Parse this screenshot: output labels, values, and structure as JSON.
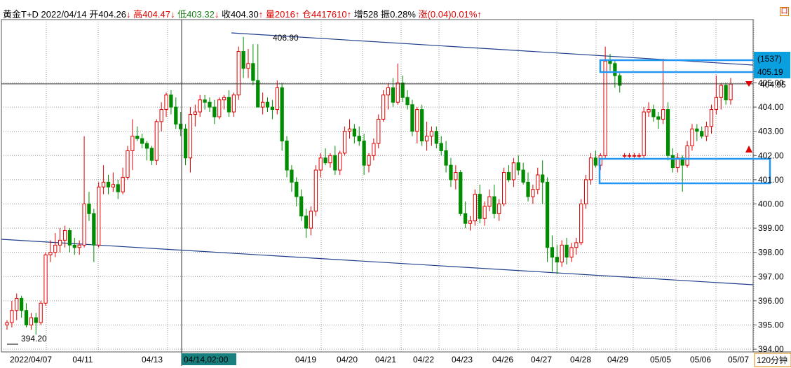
{
  "header": {
    "symbol": "黄金T+D",
    "date": "2022/04/14",
    "open_label": "开",
    "open": "404.26",
    "open_arrow": "↓",
    "high_label": "高",
    "high": "404.47",
    "high_arrow": "↓",
    "low_label": "低",
    "low": "403.32",
    "low_arrow": "↓",
    "close_label": "收",
    "close": "404.30",
    "close_arrow": "↑",
    "vol_label": "量",
    "vol": "2016",
    "vol_arrow": "↑",
    "oi_label": "仓",
    "oi": "4417610",
    "oi_arrow": "↑",
    "inc_label": "增",
    "inc": "528",
    "amp_label": "振",
    "amp": "0.28%",
    "chg_label": "涨",
    "chg": "(0.04)",
    "chg_pct": "0.01%",
    "chg_arrow": "↑",
    "corner": "口"
  },
  "period": "120分钟",
  "crosshair_date": "04/14,02:00",
  "badge_top": "(1537)",
  "badge_price": "405.19",
  "last_price": "404.95",
  "colors": {
    "up": "#e00000",
    "down": "#008c00",
    "box": "#2196f3",
    "trend": "#1f3f8c",
    "badge_bg": "#0aa0e0"
  },
  "chart_data": {
    "type": "candlestick",
    "ylim": [
      393.9,
      407.5
    ],
    "y_ticks": [
      "394.00",
      "395.00",
      "396.00",
      "397.00",
      "398.00",
      "399.00",
      "400.00",
      "401.00",
      "402.00",
      "403.00",
      "404.00",
      "405.00"
    ],
    "x_ticks": [
      "2022/04/07",
      "04/11",
      "04/13",
      "04/19",
      "04/20",
      "04/21",
      "04/22",
      "04/23",
      "04/26",
      "04/27",
      "04/28",
      "04/29",
      "05/05",
      "05/06",
      "05/07"
    ],
    "high_label": "406.90",
    "low_label": "394.20",
    "candles": [
      [
        395.0,
        395.2,
        394.8,
        395.1
      ],
      [
        395.1,
        396.0,
        394.9,
        395.6
      ],
      [
        395.6,
        396.3,
        395.2,
        396.1
      ],
      [
        396.1,
        396.2,
        395.3,
        395.6
      ],
      [
        395.6,
        395.9,
        394.9,
        395.0
      ],
      [
        395.0,
        395.5,
        394.8,
        395.3
      ],
      [
        395.3,
        395.5,
        394.6,
        395.1
      ],
      [
        395.1,
        396.0,
        395.0,
        395.9
      ],
      [
        395.9,
        398.0,
        395.8,
        397.9
      ],
      [
        397.9,
        398.5,
        397.6,
        398.0
      ],
      [
        398.0,
        398.8,
        397.8,
        398.3
      ],
      [
        398.3,
        399.0,
        398.0,
        398.5
      ],
      [
        398.5,
        399.1,
        398.2,
        398.9
      ],
      [
        398.9,
        399.0,
        398.0,
        398.3
      ],
      [
        398.3,
        398.6,
        397.9,
        398.2
      ],
      [
        398.2,
        398.5,
        397.9,
        398.3
      ],
      [
        398.3,
        402.8,
        398.2,
        400.0
      ],
      [
        400.0,
        400.5,
        399.3,
        399.6
      ],
      [
        399.6,
        399.8,
        397.6,
        398.3
      ],
      [
        398.3,
        400.9,
        398.2,
        400.7
      ],
      [
        400.7,
        401.6,
        400.4,
        400.9
      ],
      [
        400.9,
        401.2,
        400.4,
        400.7
      ],
      [
        400.7,
        401.3,
        400.5,
        400.8
      ],
      [
        400.8,
        401.0,
        400.2,
        400.5
      ],
      [
        400.5,
        401.5,
        400.4,
        401.1
      ],
      [
        401.1,
        402.4,
        401.0,
        402.2
      ],
      [
        402.2,
        403.5,
        401.4,
        402.8
      ],
      [
        402.8,
        403.2,
        402.6,
        402.7
      ],
      [
        402.7,
        402.9,
        402.3,
        402.5
      ],
      [
        402.5,
        402.6,
        401.8,
        402.3
      ],
      [
        402.3,
        402.4,
        401.6,
        401.8
      ],
      [
        401.8,
        403.5,
        401.6,
        403.4
      ],
      [
        403.4,
        404.2,
        403.0,
        403.9
      ],
      [
        403.9,
        404.6,
        403.6,
        404.5
      ],
      [
        404.5,
        404.7,
        403.7,
        404.0
      ],
      [
        404.0,
        404.4,
        403.1,
        403.3
      ],
      [
        403.3,
        403.8,
        402.8,
        403.1
      ],
      [
        403.1,
        403.3,
        401.6,
        401.9
      ],
      [
        401.9,
        404.0,
        401.3,
        403.7
      ],
      [
        403.7,
        404.1,
        403.2,
        403.8
      ],
      [
        403.8,
        404.5,
        403.6,
        404.3
      ],
      [
        404.3,
        404.5,
        403.9,
        404.2
      ],
      [
        404.2,
        404.4,
        403.8,
        404.0
      ],
      [
        404.0,
        404.3,
        403.3,
        403.6
      ],
      [
        403.6,
        404.4,
        403.5,
        404.3
      ],
      [
        404.3,
        404.5,
        403.9,
        404.4
      ],
      [
        404.4,
        404.7,
        403.6,
        403.8
      ],
      [
        403.8,
        404.6,
        403.6,
        404.5
      ],
      [
        404.5,
        406.5,
        404.3,
        406.3
      ],
      [
        406.3,
        406.9,
        405.2,
        405.6
      ],
      [
        405.6,
        406.4,
        405.2,
        405.8
      ],
      [
        405.8,
        406.6,
        404.9,
        405.1
      ],
      [
        405.1,
        406.6,
        404.0,
        404.0
      ],
      [
        404.0,
        404.6,
        403.7,
        404.2
      ],
      [
        404.2,
        404.4,
        403.8,
        404.0
      ],
      [
        404.0,
        404.3,
        403.5,
        403.9
      ],
      [
        403.9,
        405.1,
        403.7,
        404.8
      ],
      [
        404.8,
        405.0,
        402.2,
        402.6
      ],
      [
        402.6,
        402.8,
        401.1,
        401.4
      ],
      [
        401.4,
        401.6,
        400.5,
        400.9
      ],
      [
        400.9,
        401.1,
        399.9,
        400.3
      ],
      [
        400.3,
        400.6,
        399.3,
        399.5
      ],
      [
        399.5,
        399.8,
        398.6,
        399.0
      ],
      [
        399.0,
        399.9,
        398.7,
        399.7
      ],
      [
        399.7,
        401.6,
        399.5,
        401.4
      ],
      [
        401.4,
        402.1,
        401.1,
        401.9
      ],
      [
        401.9,
        402.3,
        401.6,
        401.7
      ],
      [
        401.7,
        402.1,
        401.5,
        402.0
      ],
      [
        402.0,
        402.4,
        401.2,
        401.4
      ],
      [
        401.4,
        402.2,
        401.2,
        402.1
      ],
      [
        402.1,
        403.2,
        402.0,
        403.0
      ],
      [
        403.0,
        403.5,
        402.7,
        403.1
      ],
      [
        403.1,
        403.3,
        402.5,
        402.8
      ],
      [
        402.8,
        403.2,
        402.4,
        402.6
      ],
      [
        402.6,
        402.9,
        401.2,
        401.6
      ],
      [
        401.6,
        402.1,
        401.3,
        402.0
      ],
      [
        402.0,
        402.7,
        401.8,
        402.5
      ],
      [
        402.5,
        403.7,
        402.3,
        403.5
      ],
      [
        403.5,
        404.7,
        403.4,
        404.5
      ],
      [
        404.5,
        405.0,
        403.9,
        404.8
      ],
      [
        404.8,
        405.2,
        404.0,
        404.2
      ],
      [
        404.2,
        405.8,
        404.1,
        405.0
      ],
      [
        405.0,
        405.3,
        404.2,
        404.4
      ],
      [
        404.4,
        404.7,
        403.9,
        404.1
      ],
      [
        404.1,
        404.3,
        402.8,
        403.0
      ],
      [
        403.0,
        404.0,
        402.5,
        403.9
      ],
      [
        403.9,
        404.1,
        402.4,
        402.6
      ],
      [
        402.6,
        403.4,
        402.2,
        402.8
      ],
      [
        402.8,
        403.2,
        402.4,
        403.0
      ],
      [
        403.0,
        403.2,
        402.3,
        402.5
      ],
      [
        402.5,
        402.8,
        402.0,
        402.2
      ],
      [
        402.2,
        402.6,
        401.3,
        401.6
      ],
      [
        401.6,
        401.9,
        400.7,
        401.0
      ],
      [
        401.0,
        401.6,
        400.6,
        401.3
      ],
      [
        401.3,
        401.4,
        399.5,
        399.6
      ],
      [
        399.6,
        400.1,
        399.0,
        399.2
      ],
      [
        399.2,
        399.5,
        398.9,
        399.3
      ],
      [
        399.3,
        400.6,
        399.1,
        400.4
      ],
      [
        400.4,
        400.8,
        399.2,
        399.4
      ],
      [
        399.4,
        400.1,
        399.1,
        399.9
      ],
      [
        399.9,
        400.6,
        399.7,
        400.3
      ],
      [
        400.3,
        400.8,
        399.4,
        399.6
      ],
      [
        399.6,
        400.2,
        399.3,
        400.0
      ],
      [
        400.0,
        401.5,
        399.9,
        401.3
      ],
      [
        401.3,
        401.6,
        400.9,
        401.0
      ],
      [
        401.0,
        401.9,
        400.7,
        401.7
      ],
      [
        401.7,
        402.0,
        401.2,
        401.4
      ],
      [
        401.4,
        401.7,
        400.8,
        400.9
      ],
      [
        400.9,
        401.3,
        400.1,
        400.3
      ],
      [
        400.3,
        400.8,
        400.0,
        400.6
      ],
      [
        400.6,
        401.5,
        400.4,
        401.2
      ],
      [
        401.2,
        401.8,
        400.0,
        400.9
      ],
      [
        400.9,
        401.1,
        397.6,
        398.2
      ],
      [
        398.2,
        398.7,
        397.2,
        397.8
      ],
      [
        397.8,
        398.3,
        397.1,
        397.6
      ],
      [
        397.6,
        398.5,
        397.4,
        398.3
      ],
      [
        398.3,
        398.6,
        397.5,
        397.8
      ],
      [
        397.8,
        398.4,
        397.6,
        398.2
      ],
      [
        398.2,
        398.6,
        397.9,
        398.4
      ],
      [
        398.4,
        400.2,
        398.3,
        400.0
      ],
      [
        400.0,
        401.2,
        399.8,
        401.0
      ],
      [
        401.0,
        402.1,
        400.8,
        401.9
      ],
      [
        401.9,
        402.2,
        401.5,
        401.6
      ],
      [
        401.6,
        402.1,
        401.4,
        402.0
      ],
      [
        402.0,
        406.5,
        401.9,
        405.9
      ],
      [
        405.9,
        406.2,
        405.5,
        405.8
      ],
      [
        405.8,
        405.9,
        404.8,
        405.3
      ],
      [
        405.3,
        405.4,
        404.6,
        404.9
      ],
      [
        402.0,
        402.1,
        401.9,
        402.0
      ],
      [
        402.0,
        402.1,
        401.9,
        402.0
      ],
      [
        402.0,
        402.1,
        401.9,
        402.0
      ],
      [
        402.0,
        402.1,
        401.9,
        402.0
      ],
      [
        402.0,
        404.0,
        401.9,
        403.8
      ],
      [
        403.8,
        404.2,
        403.6,
        403.9
      ],
      [
        403.9,
        404.1,
        403.4,
        403.6
      ],
      [
        403.6,
        403.8,
        403.1,
        403.5
      ],
      [
        403.5,
        406.0,
        403.3,
        403.9
      ],
      [
        403.9,
        404.2,
        401.8,
        402.0
      ],
      [
        402.0,
        402.3,
        401.3,
        401.5
      ],
      [
        401.5,
        402.1,
        401.3,
        401.9
      ],
      [
        401.9,
        402.0,
        400.5,
        401.6
      ],
      [
        401.6,
        402.6,
        401.5,
        402.4
      ],
      [
        402.4,
        403.3,
        402.2,
        403.1
      ],
      [
        403.1,
        403.3,
        402.6,
        403.0
      ],
      [
        403.0,
        403.2,
        402.7,
        402.8
      ],
      [
        402.8,
        403.4,
        402.6,
        403.2
      ],
      [
        403.2,
        404.1,
        402.9,
        403.9
      ],
      [
        403.9,
        405.3,
        403.7,
        404.4
      ],
      [
        404.4,
        405.0,
        403.9,
        404.9
      ],
      [
        404.9,
        405.0,
        404.1,
        404.3
      ],
      [
        404.3,
        405.2,
        404.1,
        404.95
      ]
    ]
  }
}
